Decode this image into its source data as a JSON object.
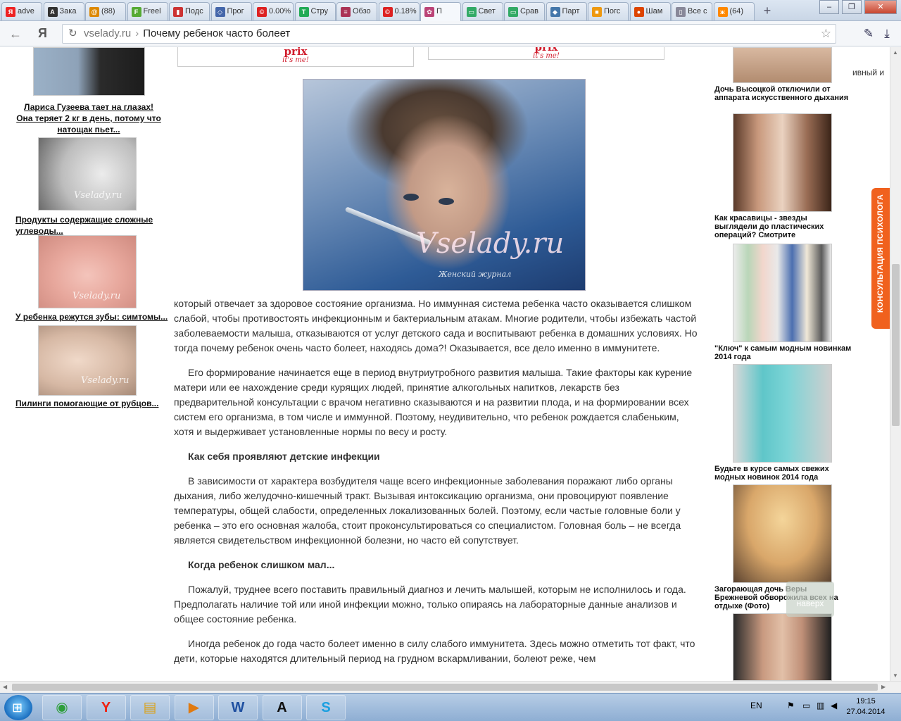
{
  "browser": {
    "tabs": [
      {
        "label": "adve",
        "fav": "Я",
        "color": "#e22"
      },
      {
        "label": "Зака",
        "fav": "A",
        "color": "#333"
      },
      {
        "label": "(88)",
        "fav": "@",
        "color": "#d80"
      },
      {
        "label": "Freel",
        "fav": "F",
        "color": "#5a3"
      },
      {
        "label": "Подс",
        "fav": "▮",
        "color": "#c33"
      },
      {
        "label": "Прог",
        "fav": "◇",
        "color": "#46a"
      },
      {
        "label": "0.00%",
        "fav": "©",
        "color": "#d22"
      },
      {
        "label": "Стру",
        "fav": "T",
        "color": "#2a5"
      },
      {
        "label": "Обзо",
        "fav": "≡",
        "color": "#a35"
      },
      {
        "label": "0.18%",
        "fav": "©",
        "color": "#d22"
      },
      {
        "label": "П",
        "fav": "✿",
        "color": "#b47"
      },
      {
        "label": "Свет",
        "fav": "▭",
        "color": "#3a6"
      },
      {
        "label": "Срав",
        "fav": "▭",
        "color": "#3a6"
      },
      {
        "label": "Парт",
        "fav": "◆",
        "color": "#47a"
      },
      {
        "label": "Погс",
        "fav": "■",
        "color": "#e91"
      },
      {
        "label": "Шам",
        "fav": "●",
        "color": "#d40"
      },
      {
        "label": "Все с",
        "fav": "▯",
        "color": "#889"
      },
      {
        "label": "(64)",
        "fav": "ж",
        "color": "#f80"
      }
    ],
    "address": {
      "host": "vselady.ru",
      "separator": "›",
      "title": "Почему ребенок часто болеет"
    },
    "yandex_button": "Я"
  },
  "left_column": [
    {
      "caption": "Лариса Гузеева тает на глазах! Она теряет 2 кг в день, потому что натощак пьет..."
    },
    {
      "caption": "Продукты содержащие сложные углеводы..."
    },
    {
      "caption": "У ребенка режутся зубы: симтомы..."
    },
    {
      "caption": "Пилинги помогающие от рубцов..."
    }
  ],
  "watermark": "Vselady.ru",
  "banners": {
    "brand": "prix",
    "slogan": "it's me!"
  },
  "hero": {
    "brand": "Vselady.ru",
    "subtitle": "Женский журнал"
  },
  "article": {
    "p1": "который отвечает за здоровое состояние организма. Но иммунная система ребенка часто оказывается слишком слабой, чтобы противостоять инфекционным и бактериальным атакам. Многие родители, чтобы избежать частой заболеваемости малыша, отказываются от услуг детского сада и воспитывают ребенка в домашних условиях. Но тогда почему ребенок очень часто болеет, находясь дома?! Оказывается, все дело именно в иммунитете.",
    "p2": "Его формирование начинается еще в период внутриутробного развития малыша. Такие факторы как курение матери или ее нахождение среди курящих людей, принятие алкогольных напитков, лекарств без предварительной консультации с врачом негативно сказываются и на развитии плода, и на формировании всех систем его организма, в том числе и иммунной. Поэтому, неудивительно, что ребенок рождается слабеньким, хотя и выдерживает установленные нормы по весу и росту.",
    "h1": "Как себя проявляют детские инфекции",
    "p3": "В зависимости от характера возбудителя чаще всего инфекционные заболевания поражают либо органы дыхания, либо желудочно-кишечный тракт. Вызывая интоксикацию организма, они провоцируют появление температуры, общей слабости, определенных локализованных болей. Поэтому, если частые головные боли у ребенка – это его основная жалоба, стоит проконсультироваться со специалистом. Головная боль – не всегда является свидетельством инфекционной болезни, но часто ей сопутствует.",
    "h2": "Когда ребенок слишком мал...",
    "p4": "Пожалуй, труднее всего поставить правильный диагноз и лечить малышей, которым не исполнилось и года. Предполагать наличие той или иной инфекции можно, только опираясь на лабораторные данные анализов и общее состояние ребенка.",
    "p5": "Иногда ребенок до года часто болеет именно в силу слабого иммунитета. Здесь можно отметить тот факт, что дети, которые находятся длительный период на грудном вскармливании, болеют реже, чем"
  },
  "right_column": [
    {
      "caption": "Дочь Высоцкой отключили от аппарата искусственного дыхания"
    },
    {
      "caption": "Как красавицы - звезды выглядели до пластических операций? Смотрите"
    },
    {
      "caption": "\"Ключ\" к самым модным новинкам 2014 года"
    },
    {
      "caption": "Будьте в курсе самых свежих модных новинок 2014 года"
    },
    {
      "caption": "Загорающая дочь Веры Брежневой обворожила всех на отдыхе (Фото)"
    }
  ],
  "right_clipped_text": "ивный и",
  "psychologist_tab": "КОНСУЛЬТАЦИЯ ПСИХОЛОГА",
  "to_top": "наверх",
  "taskbar": {
    "lang": "EN",
    "time": "19:15",
    "date": "27.04.2014",
    "apps": [
      {
        "glyph": "◉",
        "color": "#2e9e3a"
      },
      {
        "glyph": "Y",
        "color": "#e21"
      },
      {
        "glyph": "▤",
        "color": "#d9a21b"
      },
      {
        "glyph": "▶",
        "color": "#e07a10"
      },
      {
        "glyph": "W",
        "color": "#1e4fa0"
      },
      {
        "glyph": "A",
        "color": "#111"
      },
      {
        "glyph": "S",
        "color": "#1a9fe0"
      }
    ]
  }
}
